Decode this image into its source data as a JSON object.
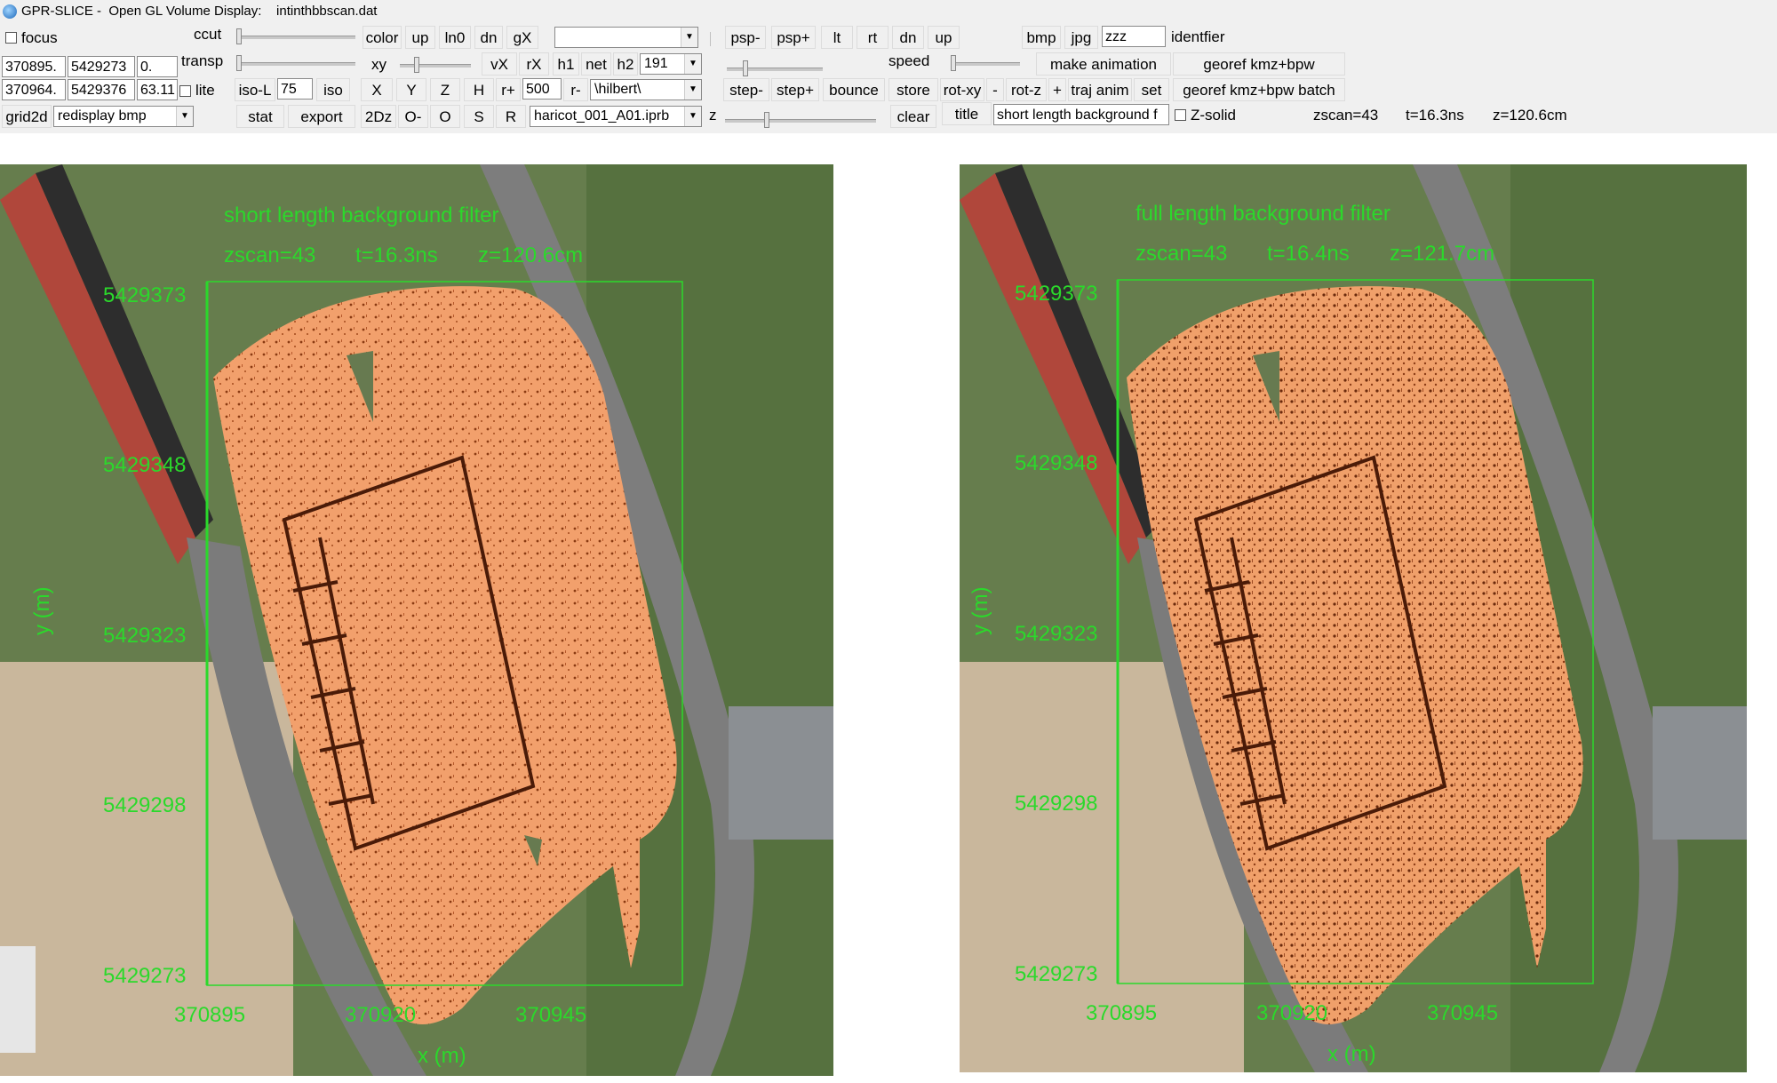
{
  "window": {
    "title": "GPR-SLICE -  Open GL Volume Display:    intinthbbscan.dat"
  },
  "toolbar": {
    "focus_label": "focus",
    "ccut_label": "ccut",
    "transp_label": "transp",
    "lite_label": "lite",
    "coord_x1": "370895.",
    "coord_y1": "5429273",
    "coord_z1": "0.",
    "coord_x2": "370964.",
    "coord_y2": "5429376",
    "coord_z2": "63.11",
    "grid2d_label": "grid2d",
    "redisplay_value": "redisplay bmp",
    "isoL_label": "iso-L",
    "isoL_value": "75",
    "iso_label": "iso",
    "stat_label": "stat",
    "export_label": "export",
    "color_label": "color",
    "up_label": "up",
    "ln0_label": "ln0",
    "dn_label": "dn",
    "gX_label": "gX",
    "xy_label": "xy",
    "vX_label": "vX",
    "rX_label": "rX",
    "h1_label": "h1",
    "net_label": "net",
    "h2_label": "h2",
    "h2_value": "191",
    "X_label": "X",
    "Y_label": "Y",
    "Z_label": "Z",
    "H_label": "H",
    "rplus_label": "r+",
    "rplus_value": "500",
    "rminus_label": "r-",
    "hilbert_value": "\\hilbert\\",
    "twoDz_label": "2Dz",
    "Ominus_label": "O-",
    "O_label": "O",
    "S_label": "S",
    "R_label": "R",
    "file_value": "haricot_001_A01.iprb",
    "z_label": "z",
    "top_combo_value": "",
    "psp_minus": "psp-",
    "psp_plus": "psp+",
    "lt": "lt",
    "rt": "rt",
    "dn2": "dn",
    "up2": "up",
    "speed_label": "speed",
    "step_minus": "step-",
    "step_plus": "step+",
    "bounce": "bounce",
    "store": "store",
    "rot_xy": "rot-xy",
    "minus": "-",
    "rot_z": "rot-z",
    "plus": "+",
    "traj_anim": "traj anim",
    "set": "set",
    "clear": "clear",
    "title_btn": "title",
    "title_field": "short length background f",
    "zsolid_label": "Z-solid",
    "bmp": "bmp",
    "jpg": "jpg",
    "identifier_value": "zzz",
    "identifier_label": "identfier",
    "make_animation": "make animation",
    "georef": "georef kmz+bpw",
    "georef_batch": "georef kmz+bpw batch",
    "status_zscan": "zscan=43",
    "status_t": "t=16.3ns",
    "status_z": "z=120.6cm"
  },
  "panels": [
    {
      "overlay_title": "short length background filter",
      "zscan": "zscan=43",
      "t": "t=16.3ns",
      "z": "z=120.6cm",
      "yticks": [
        "5429373",
        "5429348",
        "5429323",
        "5429298",
        "5429273"
      ],
      "xticks": [
        "370895",
        "370920",
        "370945"
      ],
      "xlabel": "x (m)",
      "ylabel": "y (m)"
    },
    {
      "overlay_title": "full length background filter",
      "zscan": "zscan=43",
      "t": "t=16.4ns",
      "z": "z=121.7cm",
      "yticks": [
        "5429373",
        "5429348",
        "5429323",
        "5429298",
        "5429273"
      ],
      "xticks": [
        "370895",
        "370920",
        "370945"
      ],
      "xlabel": "x (m)",
      "ylabel": "y (m)"
    }
  ],
  "colors": {
    "overlay_green": "#2bd92b",
    "gpr_orange": "#f2a06c",
    "gpr_dark": "#5a1d05",
    "grass": "#5f7a45"
  }
}
